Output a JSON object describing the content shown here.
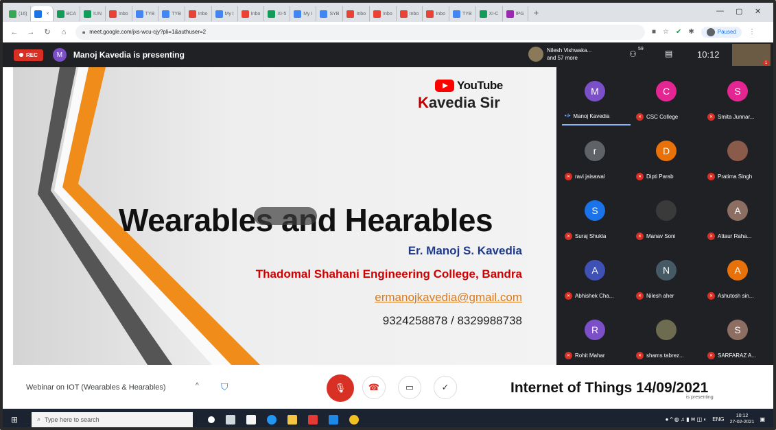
{
  "browser": {
    "tabs": [
      {
        "label": "(16)",
        "color": "#34a853",
        "active": false
      },
      {
        "label": "",
        "color": "#1a73e8",
        "active": true
      },
      {
        "label": "BCA",
        "color": "#0f9d58",
        "active": false
      },
      {
        "label": "IUN",
        "color": "#0f9d58",
        "active": false
      },
      {
        "label": "Inbo",
        "color": "#ea4335",
        "active": false
      },
      {
        "label": "TYB",
        "color": "#4285f4",
        "active": false
      },
      {
        "label": "TYB",
        "color": "#4285f4",
        "active": false
      },
      {
        "label": "Inbo",
        "color": "#ea4335",
        "active": false
      },
      {
        "label": "My I",
        "color": "#4285f4",
        "active": false
      },
      {
        "label": "Inbo",
        "color": "#ea4335",
        "active": false
      },
      {
        "label": "XI-5",
        "color": "#0f9d58",
        "active": false
      },
      {
        "label": "My I",
        "color": "#4285f4",
        "active": false
      },
      {
        "label": "SYB",
        "color": "#4285f4",
        "active": false
      },
      {
        "label": "Inbo",
        "color": "#ea4335",
        "active": false
      },
      {
        "label": "Inbo",
        "color": "#ea4335",
        "active": false
      },
      {
        "label": "Inbo",
        "color": "#ea4335",
        "active": false
      },
      {
        "label": "Inbo",
        "color": "#ea4335",
        "active": false
      },
      {
        "label": "TYB",
        "color": "#4285f4",
        "active": false
      },
      {
        "label": "XI-C",
        "color": "#0f9d58",
        "active": false
      },
      {
        "label": "IPG",
        "color": "#9c27b0",
        "active": false
      }
    ],
    "new_tab": "+",
    "url": "meet.google.com/jxs-wcu-cjy?pli=1&authuser=2",
    "paused_label": "Paused"
  },
  "meet": {
    "rec_label": "REC",
    "presenter_initial": "M",
    "presenting_text": "Manoj Kavedia is presenting",
    "viewers_line1": "Nilesh Vishwaka...",
    "viewers_line2": "and 57 more",
    "people_count": "59",
    "clock": "10:12",
    "meeting_name": "Webinar on IOT (Wearables & Hearables)",
    "overlay_title": "Internet of Things 14/09/2021",
    "is_presenting": "is presenting"
  },
  "slide": {
    "youtube": "YouTube",
    "channel_k": "K",
    "channel_rest": "avedia Sir",
    "title": "Wearables and Hearables",
    "author": "Er. Manoj S. Kavedia",
    "college": "Thadomal Shahani Engineering College, Bandra",
    "email": "ermanojkavedia@gmail.com",
    "phone": "9324258878 / 8329988738"
  },
  "participants": [
    {
      "initial": "M",
      "name": "Manoj Kavedia",
      "color": "#7b4fc8",
      "speaking": true
    },
    {
      "initial": "C",
      "name": "CSC College",
      "color": "#e52592",
      "speaking": false
    },
    {
      "initial": "S",
      "name": "Smita Junnar...",
      "color": "#e52592",
      "speaking": false
    },
    {
      "initial": "r",
      "name": "ravi jaisawal",
      "color": "#5f6368",
      "speaking": false
    },
    {
      "initial": "D",
      "name": "Dipti Parab",
      "color": "#e8710a",
      "speaking": false
    },
    {
      "initial": "",
      "name": "Pratima Singh",
      "color": "#8a5a4a",
      "speaking": false
    },
    {
      "initial": "S",
      "name": "Suraj Shukla",
      "color": "#1a73e8",
      "speaking": false
    },
    {
      "initial": "",
      "name": "Manav Soni",
      "color": "#3a3a3a",
      "speaking": false
    },
    {
      "initial": "A",
      "name": "Attaur Raha...",
      "color": "#8d6e63",
      "speaking": false
    },
    {
      "initial": "A",
      "name": "Abhishek Cha...",
      "color": "#3f51b5",
      "speaking": false
    },
    {
      "initial": "N",
      "name": "Nilesh aher",
      "color": "#455a64",
      "speaking": false
    },
    {
      "initial": "A",
      "name": "Ashutosh sin...",
      "color": "#e8710a",
      "speaking": false
    },
    {
      "initial": "R",
      "name": "Rohit Mahar",
      "color": "#7b4fc8",
      "speaking": false
    },
    {
      "initial": "",
      "name": "shams tabrez...",
      "color": "#6d6b50",
      "speaking": false
    },
    {
      "initial": "S",
      "name": "SARFARAZ A...",
      "color": "#8d6e63",
      "speaking": false
    }
  ],
  "taskbar": {
    "search_placeholder": "Type here to search",
    "time": "10:12",
    "date": "27-02-2021",
    "lang": "ENG"
  },
  "icons": {
    "start": "windows-icon",
    "search": "search-icon",
    "mic_off": "mic-off-icon",
    "end_call": "phone-hangup-icon",
    "camera": "camera-icon",
    "check": "check-icon",
    "shield": "shield-icon"
  },
  "colors": {
    "meet_dark": "#202124",
    "rec_red": "#d93025",
    "accent_blue": "#1a73e8"
  }
}
